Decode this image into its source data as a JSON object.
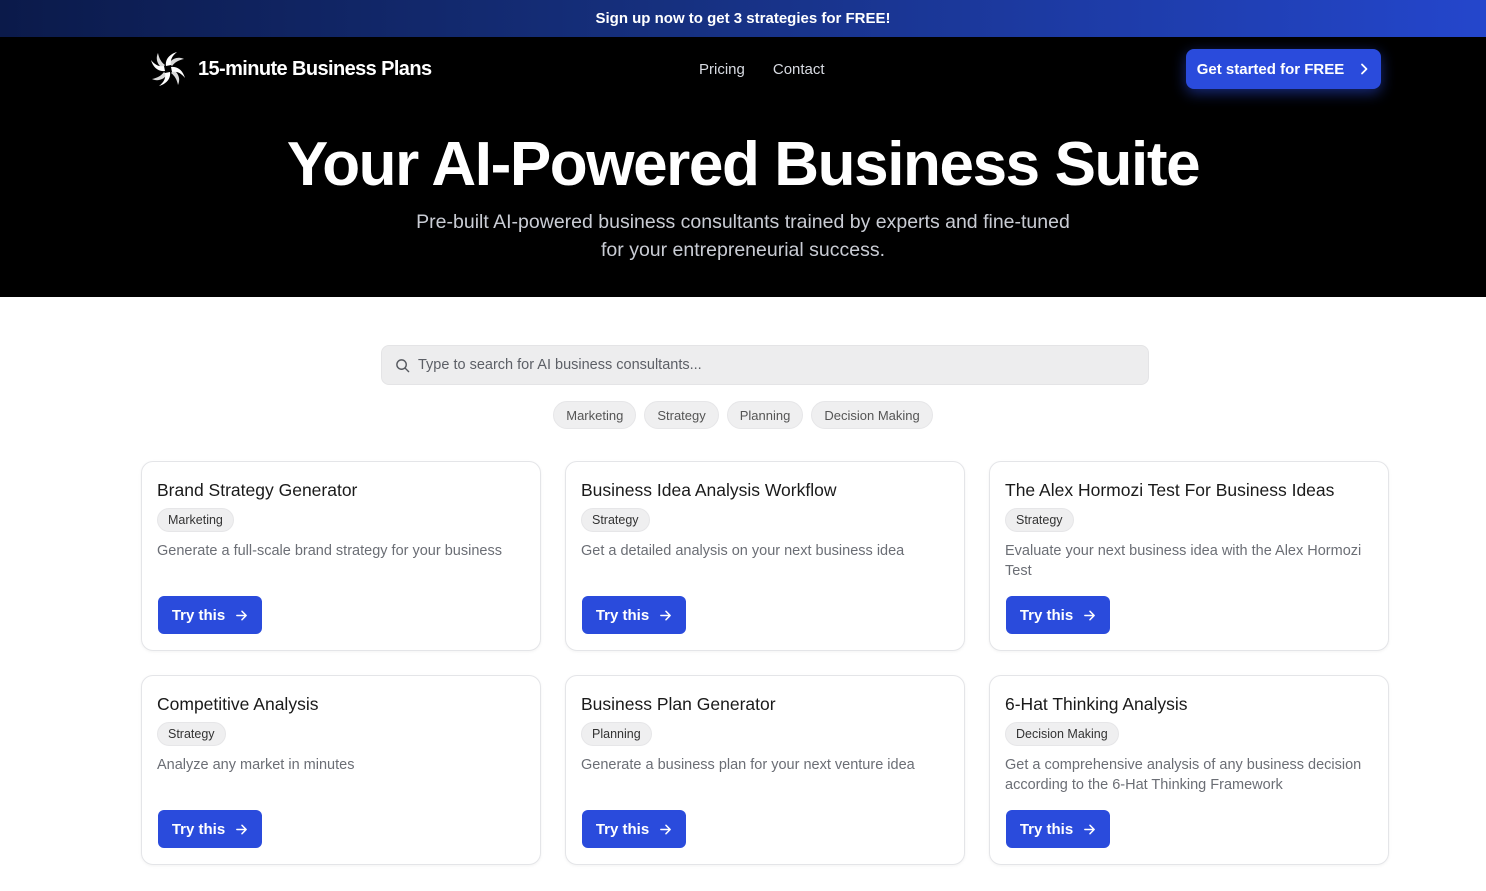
{
  "banner": {
    "text": "Sign up now to get 3 strategies for FREE!"
  },
  "nav": {
    "brand": "15-minute Business Plans",
    "links": [
      "Pricing",
      "Contact"
    ],
    "cta_label": "Get started for FREE"
  },
  "hero": {
    "title": "Your AI-Powered Business Suite",
    "subtitle_line1": "Pre-built AI-powered business consultants trained by experts and fine-tuned",
    "subtitle_line2": "for your entrepreneurial success."
  },
  "search": {
    "placeholder": "Type to search for AI business consultants..."
  },
  "filters": [
    "Marketing",
    "Strategy",
    "Planning",
    "Decision Making"
  ],
  "cards": [
    {
      "title": "Brand Strategy Generator",
      "tag": "Marketing",
      "description": "Generate a full-scale brand strategy for your business",
      "button": "Try this"
    },
    {
      "title": "Business Idea Analysis Workflow",
      "tag": "Strategy",
      "description": "Get a detailed analysis on your next business idea",
      "button": "Try this"
    },
    {
      "title": "The Alex Hormozi Test For Business Ideas",
      "tag": "Strategy",
      "description": "Evaluate your next business idea with the Alex Hormozi Test",
      "button": "Try this"
    },
    {
      "title": "Competitive Analysis",
      "tag": "Strategy",
      "description": "Analyze any market in minutes",
      "button": "Try this"
    },
    {
      "title": "Business Plan Generator",
      "tag": "Planning",
      "description": "Generate a business plan for your next venture idea",
      "button": "Try this"
    },
    {
      "title": "6-Hat Thinking Analysis",
      "tag": "Decision Making",
      "description": "Get a comprehensive analysis of any business decision according to the 6-Hat Thinking Framework",
      "button": "Try this"
    }
  ],
  "colors": {
    "primary": "#2a4bdc",
    "hero_bg": "#000000",
    "banner_start": "#0b1a4a",
    "banner_end": "#2446cc"
  },
  "icons": {
    "logo": "swirl-logo-icon",
    "cta_arrow": "chevron-right-icon",
    "search": "search-icon",
    "try_arrow": "arrow-right-icon"
  }
}
